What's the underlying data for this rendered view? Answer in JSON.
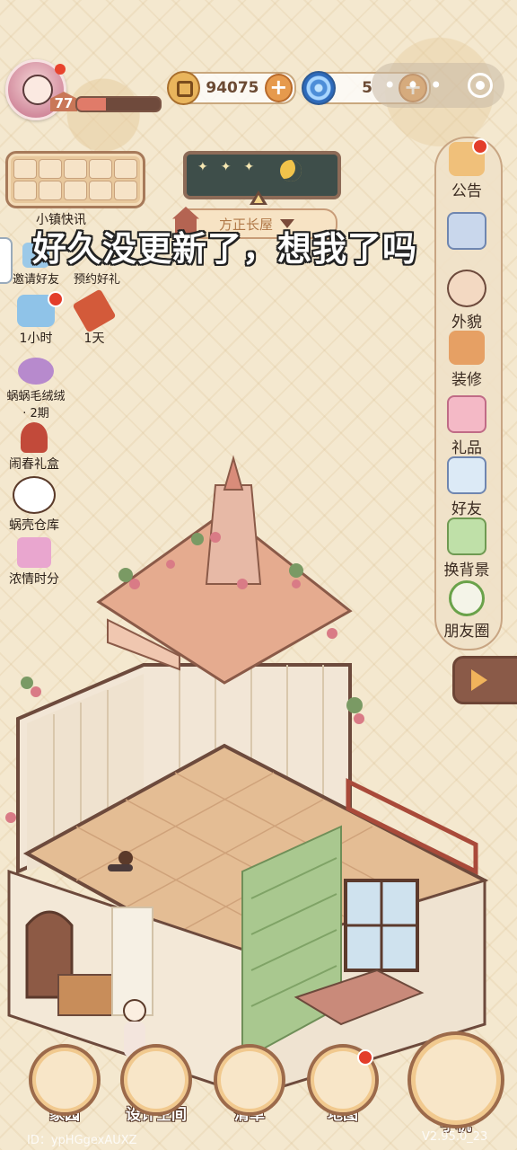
{
  "hud": {
    "level": "77",
    "xp_fraction": 0.35,
    "coins": "94075",
    "gems": "5",
    "plus": "+"
  },
  "news": {
    "title": "小镇快讯"
  },
  "location": {
    "name": "方正长屋"
  },
  "subtitle": "好久没更新了，想我了吗",
  "left_menu": {
    "invite": "邀请好友",
    "reserve": "预约好礼",
    "timer_1": "1小时",
    "timer_2": "1天",
    "event": "蜗蜗毛绒绒",
    "event_sub": "· 2期",
    "gift_box": "闹春礼盒",
    "warehouse": "蜗壳仓库",
    "love_time": "浓情时分"
  },
  "right_menu": {
    "notice": "公告",
    "mail": "",
    "appearance": "外貌",
    "decorate": "装修",
    "gift": "礼品",
    "friends": "好友",
    "background": "换背景",
    "moments": "朋友圈"
  },
  "bottom_nav": {
    "home": "家园",
    "design": "设计空间",
    "list": "清单",
    "map": "地图",
    "phone": "手机"
  },
  "footer": {
    "id": "ID：ypHGgexAUXZ",
    "version": "V2.95.0_23"
  },
  "colors": {
    "background": "#f4e8cf",
    "accent": "#9c6a4a",
    "notification": "#e33d2a"
  }
}
